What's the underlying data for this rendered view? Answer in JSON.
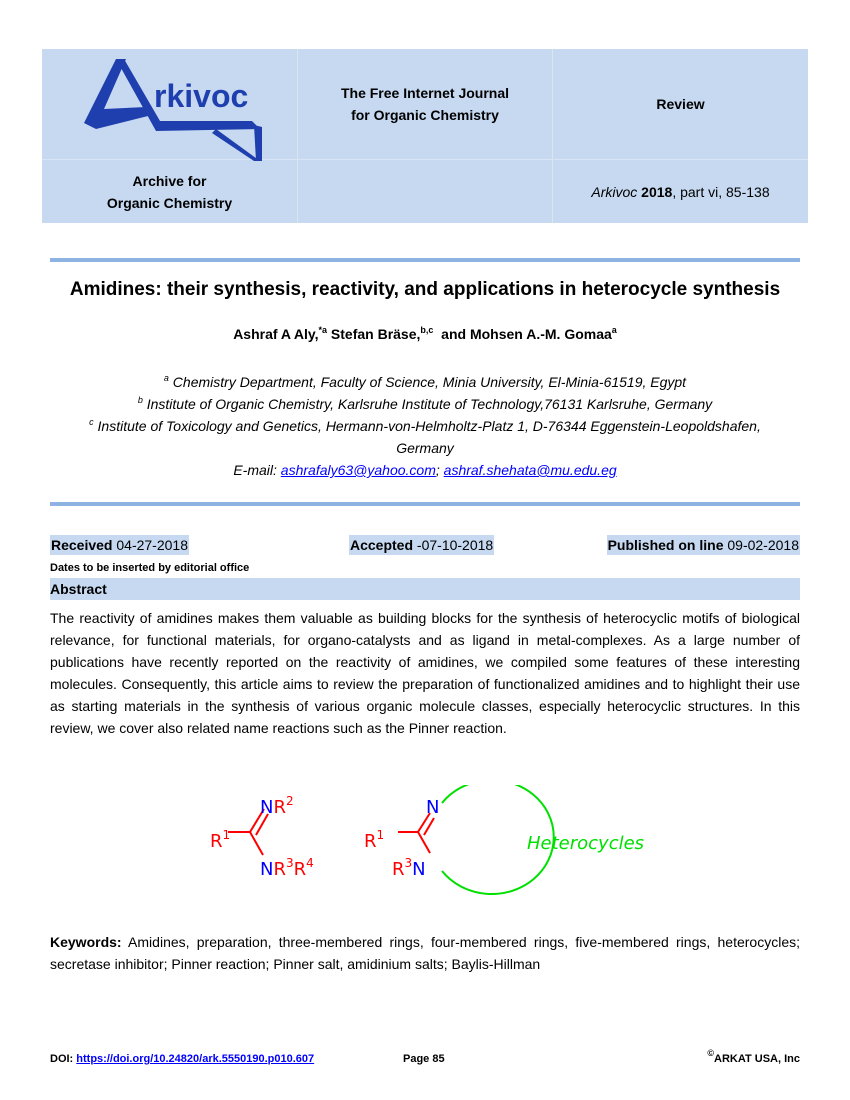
{
  "header": {
    "logo_text": "Arkivoc",
    "journal_line1": "The Free Internet Journal",
    "journal_line2": "for Organic Chemistry",
    "article_type": "Review",
    "archive_line1": "Archive for",
    "archive_line2": "Organic Chemistry",
    "citation_journal": "Arkivoc",
    "citation_year": "2018",
    "citation_rest": ", part vi, 85-138"
  },
  "article": {
    "title": "Amidines: their synthesis, reactivity, and applications in heterocycle synthesis",
    "authors": [
      {
        "name": "Ashraf A Aly,",
        "sup": "*a"
      },
      {
        "name": " Stefan Bräse,",
        "sup": "b,c"
      },
      {
        "name": "  and Mohsen A.-M. Gomaa",
        "sup": "a"
      }
    ],
    "affiliations": [
      {
        "sup": "a",
        "text": " Chemistry Department, Faculty of Science, Minia University, El-Minia-61519, Egypt"
      },
      {
        "sup": "b",
        "text": " Institute of Organic Chemistry, Karlsruhe Institute of Technology,76131 Karlsruhe, Germany"
      },
      {
        "sup": "c",
        "text": " Institute of Toxicology and Genetics, Hermann-von-Helmholtz-Platz 1, D-76344 Eggenstein-Leopoldshafen,"
      },
      {
        "sup": "",
        "text": "Germany"
      }
    ],
    "email_label": "E-mail: ",
    "email_1": "ashrafaly63@yahoo.com",
    "email_sep": "; ",
    "email_2": "ashraf.shehata@mu.edu.eg"
  },
  "dates": {
    "received_label": "Received",
    "received_value": " 04-27-2018",
    "accepted_label": "Accepted",
    "accepted_value": " -07-10-2018",
    "published_label": "Published on line",
    "published_value": " 09-02-2018",
    "note": "Dates to be inserted by editorial office"
  },
  "abstract": {
    "heading": "Abstract",
    "text": "The reactivity of amidines makes them valuable as building blocks for the synthesis of heterocyclic motifs of biological relevance, for functional materials, for organo-catalysts and as ligand in metal-complexes. As a large number of publications have recently reported on the reactivity of amidines, we compiled some features of these interesting molecules. Consequently, this article aims to review the preparation of functionalized amidines and to highlight their use as starting materials in the synthesis of various organic molecule classes, especially heterocyclic structures. In this review, we cover also related name reactions such as the Pinner reaction."
  },
  "scheme": {
    "colors": {
      "r_group": "#ff0000",
      "nitrogen": "#0000ff",
      "ring": "#00e000"
    },
    "amidine": {
      "r1": "R",
      "r1_sup": "1",
      "n_top": "N",
      "r2": "R",
      "r2_sup": "2",
      "n_bottom": "N",
      "r3": "R",
      "r3_sup": "3",
      "r4": "R",
      "r4_sup": "4"
    },
    "cyclic": {
      "r1": "R",
      "r1_sup": "1",
      "n_top": "N",
      "r3": "R",
      "r3_sup": "3",
      "n_bottom": "N"
    },
    "label": "Heterocycles"
  },
  "keywords": {
    "label": "Keywords:",
    "text": " Amidines, preparation, three-membered rings, four-membered rings, five-membered rings, heterocycles; secretase inhibitor; Pinner reaction; Pinner salt, amidinium salts; Baylis-Hillman"
  },
  "footer": {
    "doi_label": "DOI: ",
    "doi_link": "https://doi.org/10.24820/ark.5550190.p010.607",
    "page": "Page 85",
    "copyright_symbol": "©",
    "copyright": "ARKAT USA, Inc"
  }
}
